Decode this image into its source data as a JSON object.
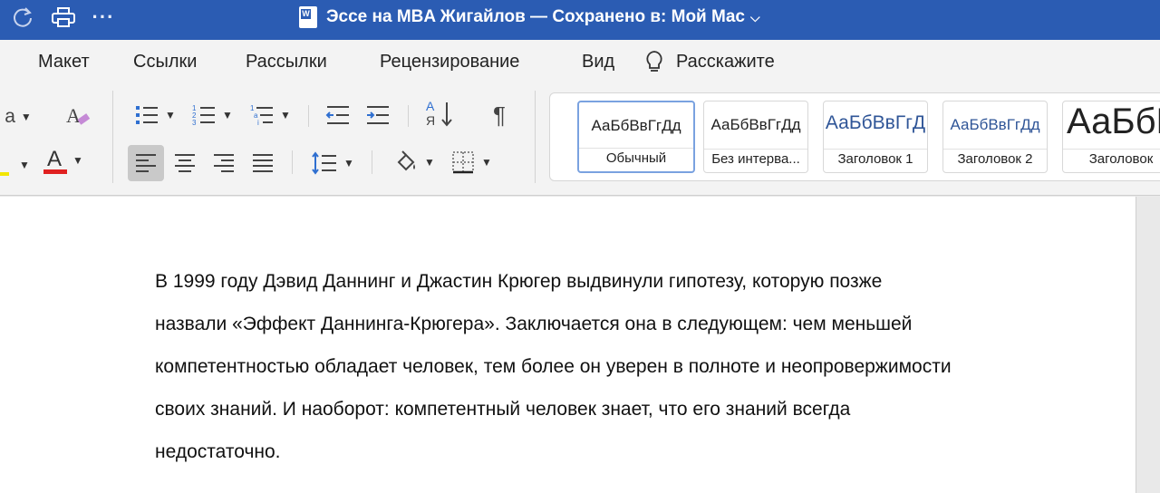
{
  "titlebar": {
    "doc_name": "Эссе на MBA Жигайлов — Сохранено в: Мой Mac",
    "word_badge": "W",
    "more_label": "···"
  },
  "ribbon_tabs": [
    {
      "label": "Макет"
    },
    {
      "label": "Ссылки"
    },
    {
      "label": "Рассылки"
    },
    {
      "label": "Рецензирование"
    },
    {
      "label": "Вид"
    },
    {
      "label": "Расскажите"
    }
  ],
  "toolbar": {
    "font_case_label": "a",
    "clear_format_label": "A",
    "font_color_label": "A",
    "sort_top": "А",
    "sort_bottom": "Я",
    "pilcrow": "¶",
    "highlight_color": "#f2e600",
    "font_color": "#e02020"
  },
  "styles": [
    {
      "sample": "АаБбВвГгДд",
      "label": "Обычный",
      "selected": true
    },
    {
      "sample": "АаБбВвГгДд",
      "label": "Без интерва..."
    },
    {
      "sample": "АаБбВвГгД",
      "label": "Заголовок 1",
      "color": "#2f5597"
    },
    {
      "sample": "АаБбВвГгДд",
      "label": "Заголовок 2",
      "color": "#2f5597"
    },
    {
      "sample": "АаБбВ",
      "label": "Заголовок"
    }
  ],
  "document": {
    "lines": [
      "В 1999 году Дэвид Даннинг и Джастин Крюгер выдвинули гипотезу, которую позже",
      "назвали «Эффект Даннинга-Крюгера». Заключается она в следующем: чем меньшей",
      "компетентностью обладает человек, тем более он уверен в полноте и неопровержимости",
      "своих знаний. И наоборот: компетентный человек знает, что его знаний всегда",
      "недостаточно."
    ]
  },
  "colors": {
    "title_bar": "#2b5cb3",
    "ribbon_bg": "#f3f3f3"
  }
}
